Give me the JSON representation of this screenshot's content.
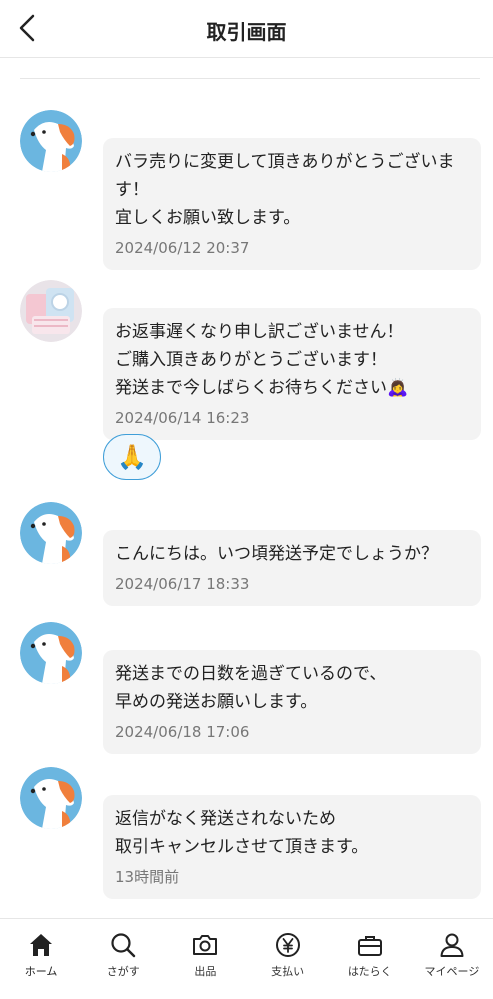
{
  "header": {
    "title": "取引画面"
  },
  "messages": [
    {
      "sender": "dog",
      "text": "バラ売りに変更して頂きありがとうございます！\n宜しくお願い致します。",
      "time": "2024/06/12 20:37"
    },
    {
      "sender": "seller",
      "text": "お返事遅くなり申し訳ございません！\nご購入頂きありがとうございます！\n発送まで今しばらくお待ちください🙇‍♀️",
      "time": "2024/06/14 16:23",
      "reaction": "🙏"
    },
    {
      "sender": "dog",
      "text": "こんにちは。いつ頃発送予定でしょうか？",
      "time": "2024/06/17 18:33"
    },
    {
      "sender": "dog",
      "text": "発送までの日数を過ぎているので、\n早めの発送お願いします。",
      "time": "2024/06/18 17:06"
    },
    {
      "sender": "dog",
      "text": "返信がなく発送されないため\n取引キャンセルさせて頂きます。",
      "time": "13時間前"
    }
  ],
  "tabbar": {
    "items": [
      {
        "label": "ホーム",
        "icon": "home-icon"
      },
      {
        "label": "さがす",
        "icon": "search-icon"
      },
      {
        "label": "出品",
        "icon": "camera-icon"
      },
      {
        "label": "支払い",
        "icon": "yen-icon"
      },
      {
        "label": "はたらく",
        "icon": "briefcase-icon"
      },
      {
        "label": "マイページ",
        "icon": "person-icon"
      }
    ]
  },
  "colors": {
    "accent": "#3f9ed8",
    "bubble": "#f3f3f3",
    "avatar_bg": "#6bb6e0",
    "dog_ear": "#f07f3c"
  }
}
